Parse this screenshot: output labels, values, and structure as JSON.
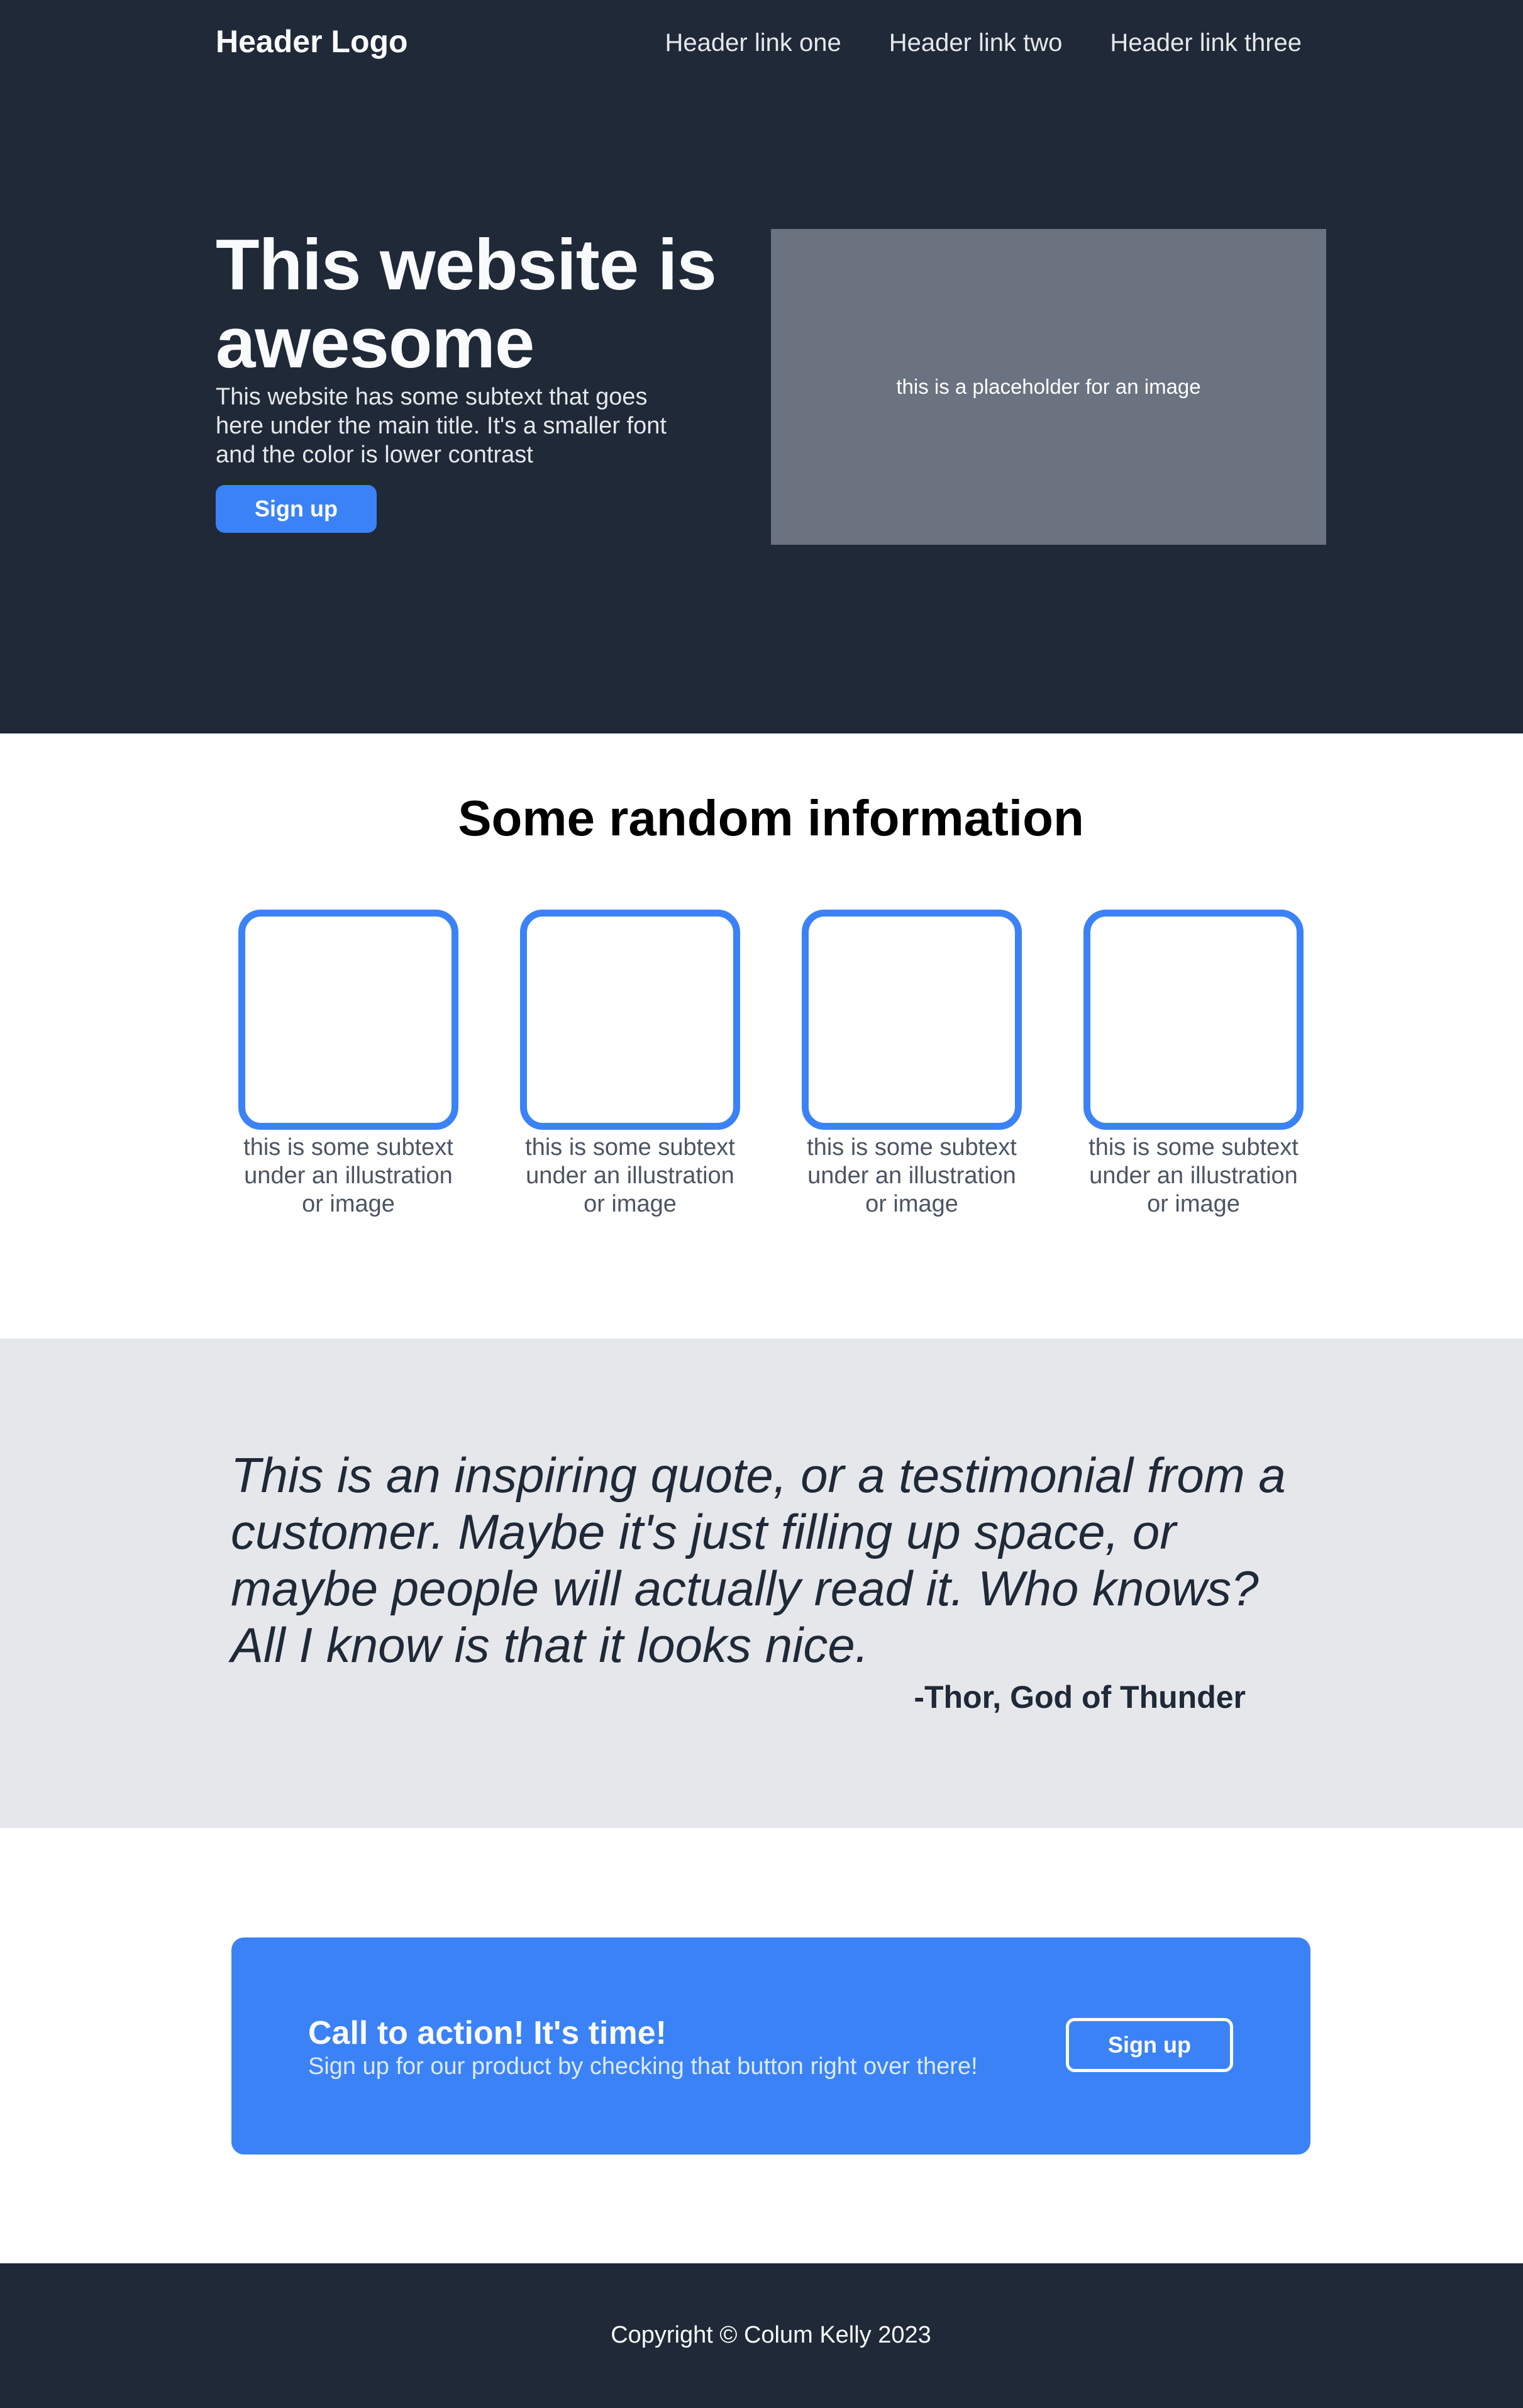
{
  "header": {
    "logo": "Header Logo",
    "nav_links": [
      "Header link one",
      "Header link two",
      "Header link three"
    ]
  },
  "hero": {
    "title": "This website is awesome",
    "subtext": "This website has some subtext that goes here under the main title. It's a smaller font and the color is lower contrast",
    "signup_label": "Sign up",
    "image_placeholder_text": "this is a placeholder for an image"
  },
  "info": {
    "title": "Some random information",
    "cards": [
      {
        "text": "this is some subtext under an illustration or image"
      },
      {
        "text": "this is some subtext under an illustration or image"
      },
      {
        "text": "this is some subtext under an illustration or image"
      },
      {
        "text": "this is some subtext under an illustration or image"
      }
    ]
  },
  "quote": {
    "text": "This is an inspiring quote, or a testimonial from a customer. Maybe it's just filling up space, or maybe people will actually read it. Who knows? All I know is that it looks nice.",
    "author": "-Thor, God of Thunder"
  },
  "cta": {
    "title": "Call to action! It's time!",
    "subtext": "Sign up for our product by checking that button right over there!",
    "signup_label": "Sign up"
  },
  "footer": {
    "copyright": "Copyright © Colum Kelly 2023"
  },
  "colors": {
    "dark_background": "#1f2937",
    "accent_blue": "#3b82f6",
    "quote_background": "#e5e7eb",
    "image_placeholder": "#6b7280"
  }
}
